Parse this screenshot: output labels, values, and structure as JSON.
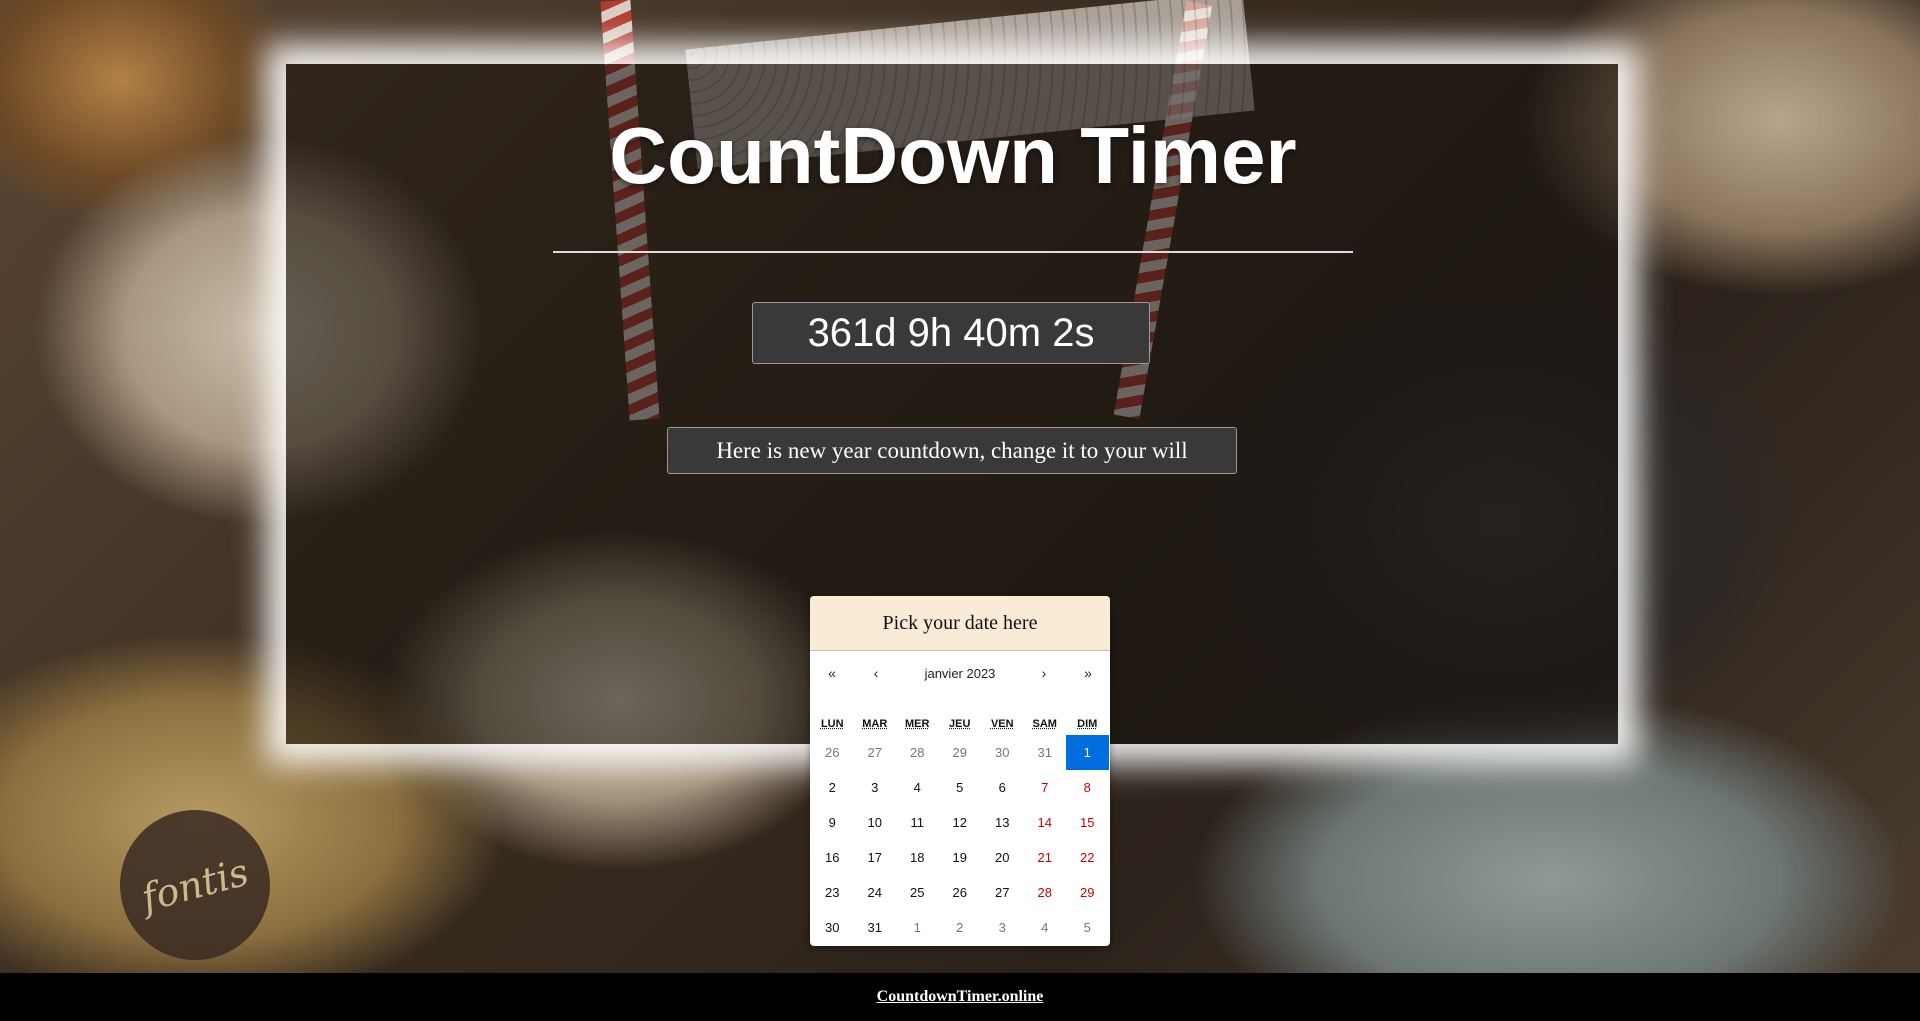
{
  "header": {
    "title": "CountDown Timer"
  },
  "timer": {
    "display": "361d 9h 40m 2s"
  },
  "message": {
    "text": "Here is new year countdown, change it to your will"
  },
  "datepicker": {
    "heading": "Pick your date here",
    "nav": {
      "prev_year": "«",
      "prev_month": "‹",
      "month_label": "janvier 2023",
      "next_month": "›",
      "next_year": "»"
    },
    "weekdays": [
      "LUN",
      "MAR",
      "MER",
      "JEU",
      "VEN",
      "SAM",
      "DIM"
    ],
    "weeks": [
      [
        "26",
        "27",
        "28",
        "29",
        "30",
        "31",
        "1"
      ],
      [
        "2",
        "3",
        "4",
        "5",
        "6",
        "7",
        "8"
      ],
      [
        "9",
        "10",
        "11",
        "12",
        "13",
        "14",
        "15"
      ],
      [
        "16",
        "17",
        "18",
        "19",
        "20",
        "21",
        "22"
      ],
      [
        "23",
        "24",
        "25",
        "26",
        "27",
        "28",
        "29"
      ],
      [
        "30",
        "31",
        "1",
        "2",
        "3",
        "4",
        "5"
      ]
    ],
    "selected_day": "1",
    "colors": {
      "selected": "#006edc",
      "weekend": "#d10000",
      "header_bg": "#faebd7"
    }
  },
  "footer": {
    "link_text": "CountdownTimer.online"
  },
  "background": {
    "logo_text": "fontis"
  }
}
